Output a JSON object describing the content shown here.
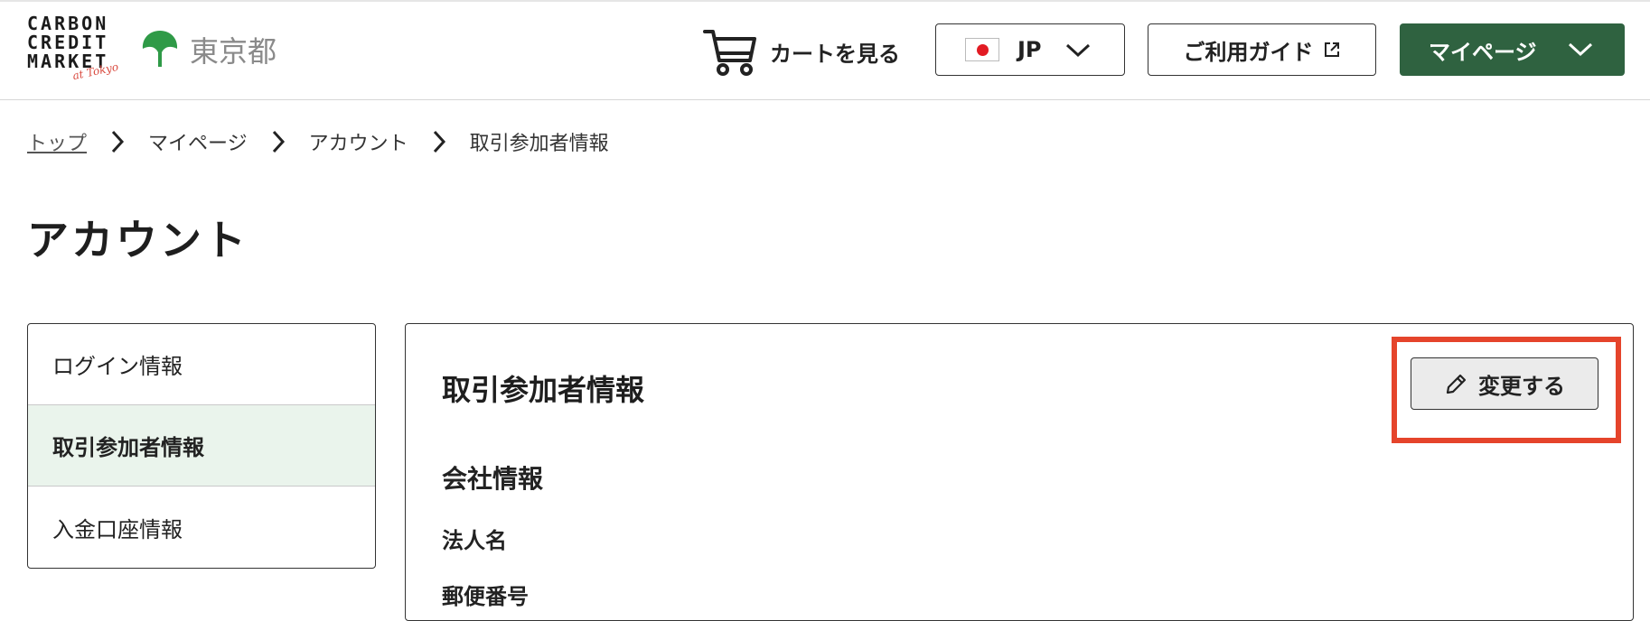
{
  "header": {
    "logo": {
      "lines": [
        "CARBON",
        "CREDIT",
        "MARKET"
      ],
      "script": "at Tokyo"
    },
    "tokyo_text": "東京都",
    "cart_label": "カートを見る",
    "cart_icon": "cart-icon",
    "language": {
      "flag": "jp-flag-icon",
      "label": "JP"
    },
    "guide_label": "ご利用ガイド",
    "guide_icon": "external-link-icon",
    "mypage_label": "マイページ",
    "colors": {
      "primary_green": "#2f6240",
      "tokyo_green": "#2f9a47",
      "highlight_red": "#e5442b"
    }
  },
  "breadcrumb": {
    "items": [
      "トップ",
      "マイページ",
      "アカウント",
      "取引参加者情報"
    ]
  },
  "page_title": "アカウント",
  "sidemenu": {
    "items": [
      "ログイン情報",
      "取引参加者情報",
      "入金口座情報"
    ],
    "active_index": 1
  },
  "panel": {
    "title": "取引参加者情報",
    "edit_label": "変更する",
    "section_heading": "会社情報",
    "fields": [
      "法人名",
      "郵便番号"
    ]
  }
}
